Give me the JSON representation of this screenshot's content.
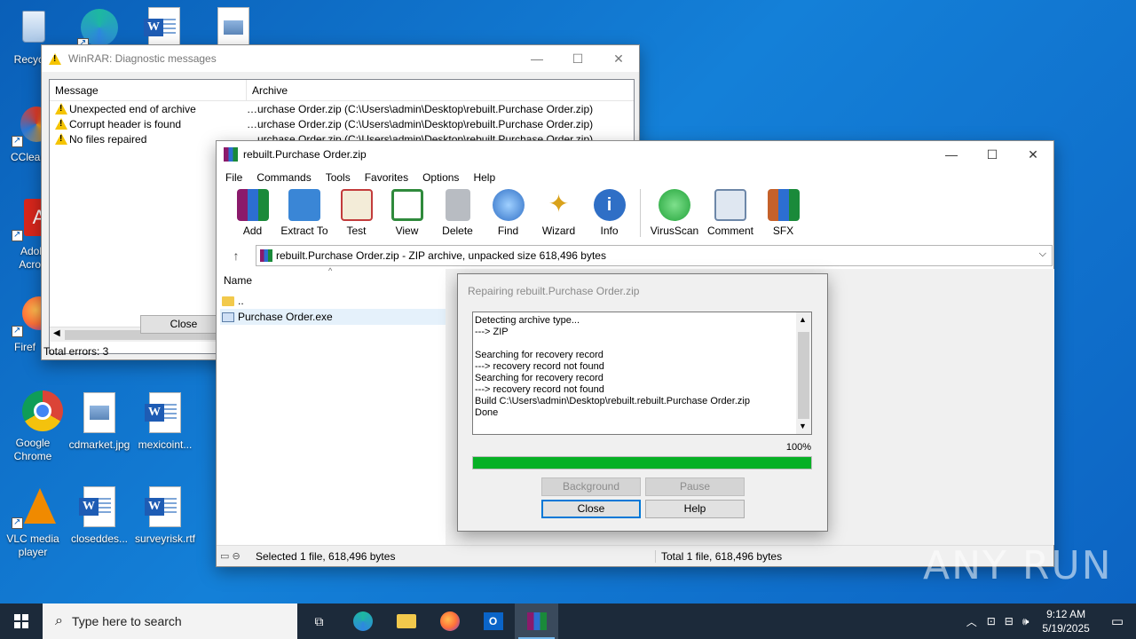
{
  "desktop": {
    "icons": [
      {
        "label": "Recycle"
      },
      {
        "label": "CClean"
      },
      {
        "label": "Adob Acrob"
      },
      {
        "label": "Firef"
      },
      {
        "label": "Google Chrome"
      },
      {
        "label": "cdmarket.jpg"
      },
      {
        "label": "mexicoint..."
      },
      {
        "label": "VLC media player"
      },
      {
        "label": "closeddes..."
      },
      {
        "label": "surveyrisk.rtf"
      }
    ]
  },
  "diag": {
    "title": "WinRAR: Diagnostic messages",
    "col_message": "Message",
    "col_archive": "Archive",
    "rows": [
      {
        "message": "Unexpected end of archive",
        "archive": "…urchase Order.zip (C:\\Users\\admin\\Desktop\\rebuilt.Purchase Order.zip)"
      },
      {
        "message": "Corrupt header is found",
        "archive": "…urchase Order.zip (C:\\Users\\admin\\Desktop\\rebuilt.Purchase Order.zip)"
      },
      {
        "message": "No files repaired",
        "archive": "…urchase Order.zip (C:\\Users\\admin\\Desktop\\rebuilt.Purchase Order.zip)"
      }
    ],
    "close_label": "Close",
    "total_errors": "Total errors: 3"
  },
  "rar": {
    "title": "rebuilt.Purchase Order.zip",
    "menu": [
      "File",
      "Commands",
      "Tools",
      "Favorites",
      "Options",
      "Help"
    ],
    "tools": [
      {
        "label": "Add",
        "color": "#b8242f"
      },
      {
        "label": "Extract To",
        "color": "#3a86d6"
      },
      {
        "label": "Test",
        "color": "#c23b3b"
      },
      {
        "label": "View",
        "color": "#2f8a3c"
      },
      {
        "label": "Delete",
        "color": "#8a8f96"
      },
      {
        "label": "Find",
        "color": "#2f6fc6"
      },
      {
        "label": "Wizard",
        "color": "#d9a21b"
      },
      {
        "label": "Info",
        "color": "#2f6fc6"
      },
      {
        "label": "VirusScan",
        "color": "#22a33a"
      },
      {
        "label": "Comment",
        "color": "#6d87a8"
      },
      {
        "label": "SFX",
        "color": "#c5612a"
      }
    ],
    "address": "rebuilt.Purchase Order.zip - ZIP archive, unpacked size 618,496 bytes",
    "col_name": "Name",
    "files": [
      {
        "name": ".."
      },
      {
        "name": "Purchase Order.exe"
      }
    ],
    "status_left": "Selected 1 file, 618,496 bytes",
    "status_right": "Total 1 file, 618,496 bytes"
  },
  "repair": {
    "title": "Repairing rebuilt.Purchase Order.zip",
    "log": [
      "Detecting archive type...",
      "---> ZIP",
      "",
      "Searching for recovery record",
      "---> recovery record not found",
      "Searching for recovery record",
      "---> recovery record not found",
      "Build C:\\Users\\admin\\Desktop\\rebuilt.rebuilt.Purchase Order.zip",
      "Done"
    ],
    "percent": "100%",
    "progress": 1.0,
    "btn_background": "Background",
    "btn_pause": "Pause",
    "btn_close": "Close",
    "btn_help": "Help"
  },
  "taskbar": {
    "search_placeholder": "Type here to search",
    "time": "9:12 AM",
    "date": "5/19/2025"
  },
  "watermark": "ANY RUN"
}
